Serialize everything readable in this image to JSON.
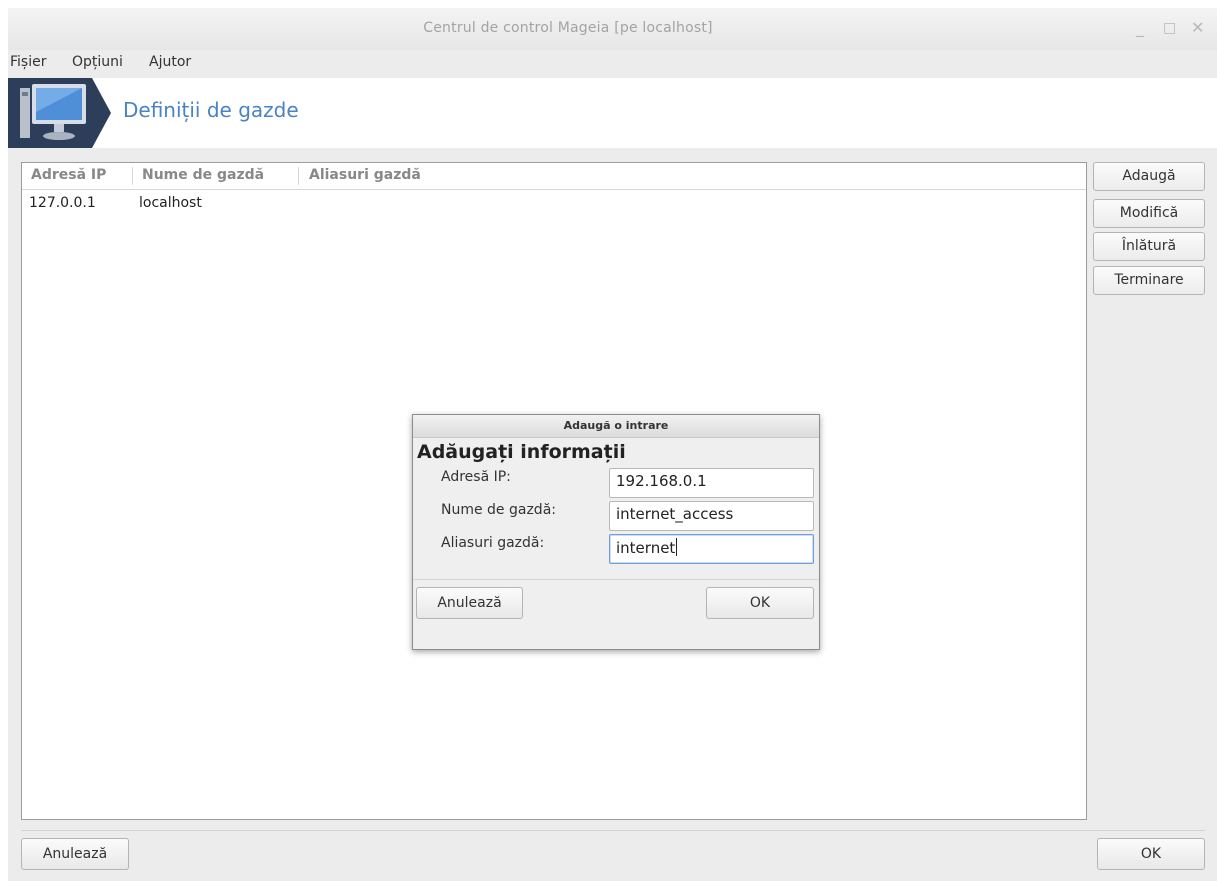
{
  "window": {
    "title": "Centrul de control Mageia  [pe localhost]",
    "controls": {
      "minimize": "_",
      "maximize": "□",
      "close": "✕"
    }
  },
  "menu": {
    "items": [
      "Fișier",
      "Opțiuni",
      "Ajutor"
    ]
  },
  "banner": {
    "title": "Definiții de gazde",
    "icon": "computer-monitor-icon"
  },
  "table": {
    "columns": [
      "Adresă IP",
      "Nume de gazdă",
      "Aliasuri gazdă"
    ],
    "rows": [
      {
        "ip": "127.0.0.1",
        "hostname": "localhost",
        "aliases": ""
      }
    ]
  },
  "side_buttons": {
    "add": "Adaugă",
    "modify": "Modifică",
    "remove": "Înlătură",
    "finish": "Terminare"
  },
  "footer": {
    "cancel": "Anulează",
    "ok": "OK"
  },
  "dialog": {
    "title": "Adaugă o intrare",
    "heading": "Adăugați informații",
    "fields": {
      "ip": {
        "label": "Adresă IP:",
        "value": "192.168.0.1"
      },
      "hostname": {
        "label": "Nume de gazdă:",
        "value": "internet_access"
      },
      "aliases": {
        "label": "Aliasuri gazdă:",
        "value": "internet"
      }
    },
    "cancel": "Anulează",
    "ok": "OK"
  },
  "colors": {
    "accent": "#4a82c9",
    "focus": "#6f9edc",
    "banner_icon_bg": "#2d3e5a"
  }
}
